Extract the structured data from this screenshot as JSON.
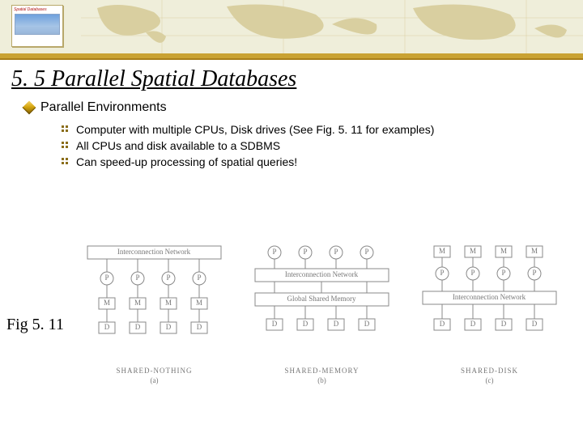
{
  "logo": {
    "title": "Spatial Databases"
  },
  "title": "5. 5 Parallel Spatial Databases",
  "bullets": {
    "lvl1": "Parallel Environments",
    "lvl2": [
      "Computer with multiple CPUs, Disk drives (See Fig. 5. 11 for examples)",
      "All CPUs and disk available to a SDBMS",
      "Can speed-up processing of spatial queries!"
    ]
  },
  "fig_label": "Fig 5. 11",
  "diagrams": {
    "interconn": "Interconnection Network",
    "gsm": "Global Shared Memory",
    "p": "P",
    "m": "M",
    "d": "D",
    "a": {
      "label": "SHARED-NOTHING",
      "sub": "(a)"
    },
    "b": {
      "label": "SHARED-MEMORY",
      "sub": "(b)"
    },
    "c": {
      "label": "SHARED-DISK",
      "sub": "(c)"
    }
  }
}
